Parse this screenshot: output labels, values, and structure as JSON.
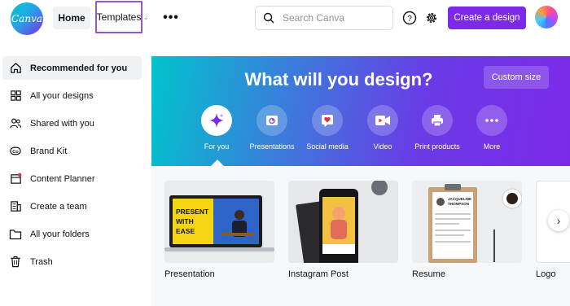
{
  "header": {
    "logo_text": "Canva",
    "nav": {
      "home": "Home",
      "templates": "Templates",
      "more": "•••"
    },
    "search": {
      "placeholder": "Search Canva",
      "value": ""
    },
    "create_button": "Create a design"
  },
  "sidebar": {
    "items": [
      {
        "label": "Recommended for you",
        "icon": "home-icon",
        "active": true
      },
      {
        "label": "All your designs",
        "icon": "grid-icon"
      },
      {
        "label": "Shared with you",
        "icon": "people-icon"
      },
      {
        "label": "Brand Kit",
        "icon": "brand-kit-icon"
      },
      {
        "label": "Content Planner",
        "icon": "calendar-icon"
      },
      {
        "label": "Create a team",
        "icon": "building-icon"
      },
      {
        "label": "All your folders",
        "icon": "folder-icon"
      },
      {
        "label": "Trash",
        "icon": "trash-icon"
      }
    ]
  },
  "hero": {
    "title": "What will you design?",
    "custom_size": "Custom size",
    "categories": [
      {
        "label": "For you",
        "icon": "sparkle-icon",
        "active": true
      },
      {
        "label": "Presentations",
        "icon": "presentation-icon"
      },
      {
        "label": "Social media",
        "icon": "heart-icon"
      },
      {
        "label": "Video",
        "icon": "video-icon"
      },
      {
        "label": "Print products",
        "icon": "printer-icon"
      },
      {
        "label": "More",
        "icon": "more-icon"
      }
    ]
  },
  "templates": [
    {
      "name": "Presentation",
      "thumb_text": "PRESENT WITH EASE"
    },
    {
      "name": "Instagram Post"
    },
    {
      "name": "Resume",
      "thumb_text": "JACQUELINE THOMPSON"
    },
    {
      "name": "Logo"
    }
  ],
  "colors": {
    "brand": "#7d2ae8",
    "hero_start": "#00c4cc",
    "hero_end": "#7d2ae8"
  }
}
